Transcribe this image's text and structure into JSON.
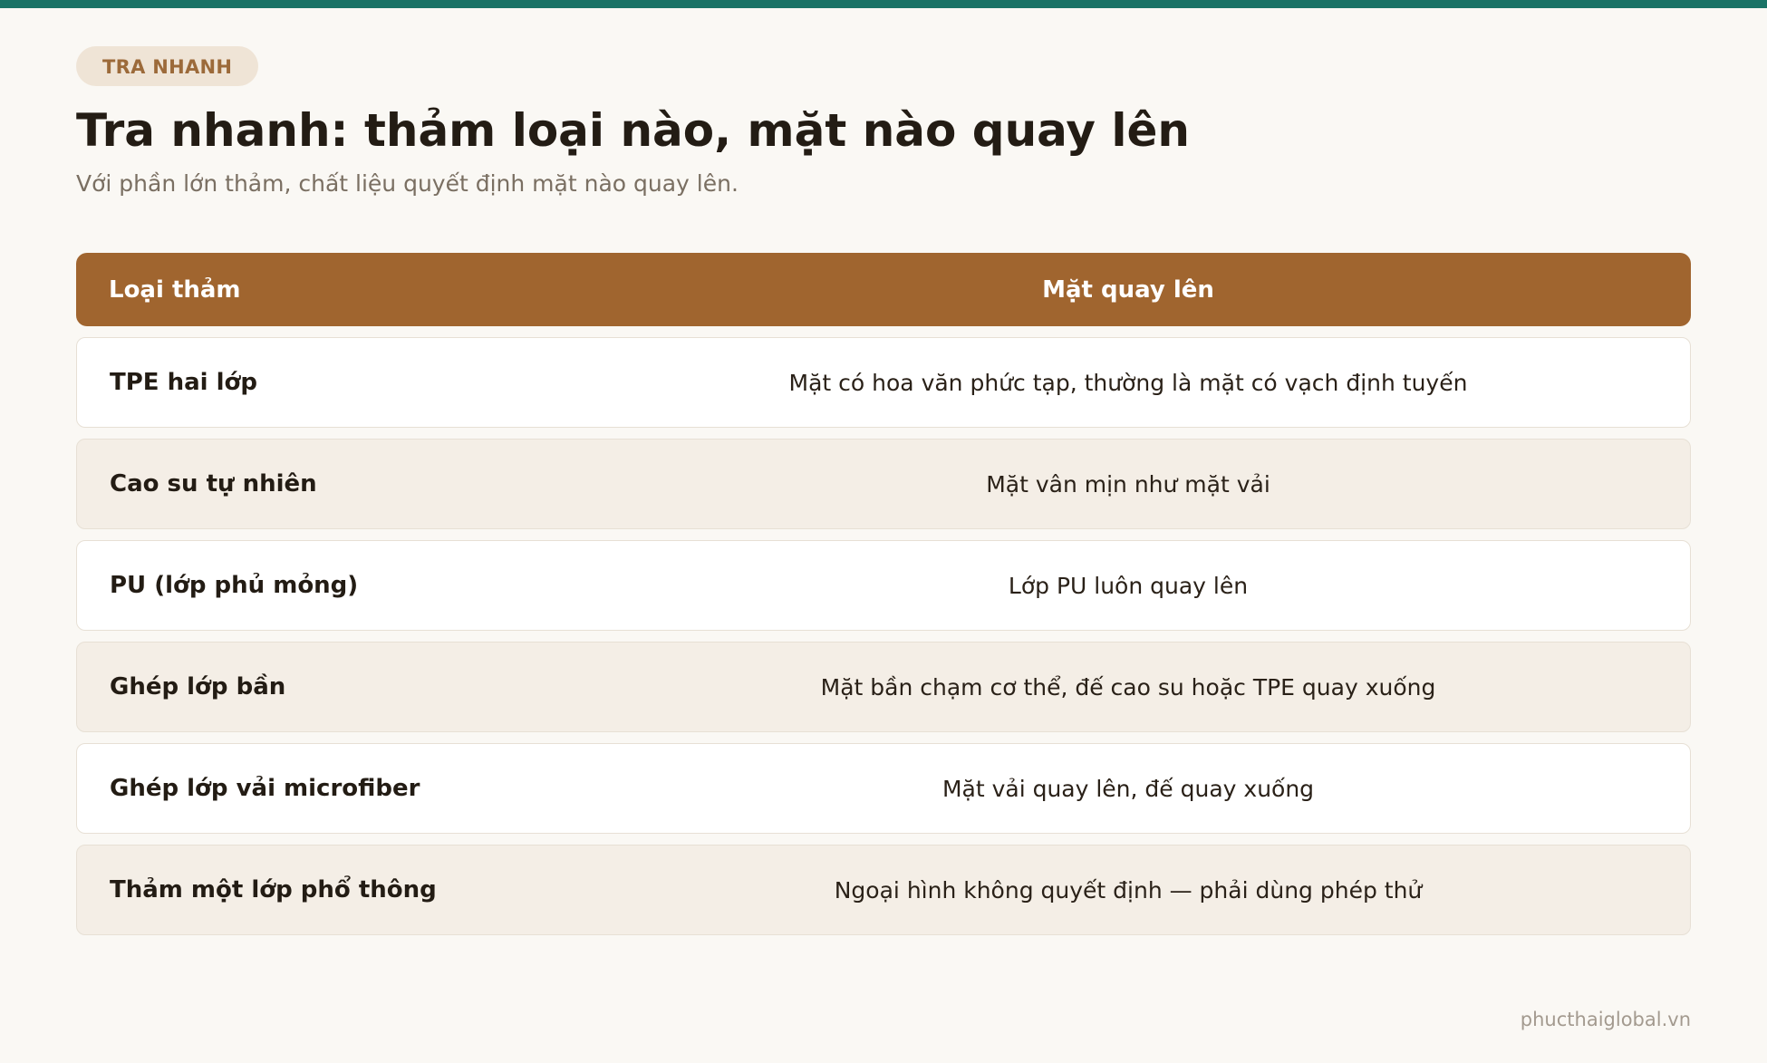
{
  "badge": "TRA NHANH",
  "title": "Tra nhanh: thảm loại nào, mặt nào quay lên",
  "subtitle": "Với phần lớn thảm, chất liệu quyết định mặt nào quay lên.",
  "table": {
    "headers": {
      "type": "Loại thảm",
      "side": "Mặt quay lên"
    },
    "rows": [
      {
        "type": "TPE hai lớp",
        "side": "Mặt có hoa văn phức tạp, thường là mặt có vạch định tuyến"
      },
      {
        "type": "Cao su tự nhiên",
        "side": "Mặt vân mịn như mặt vải"
      },
      {
        "type": "PU (lớp phủ mỏng)",
        "side": "Lớp PU luôn quay lên"
      },
      {
        "type": "Ghép lớp bần",
        "side": "Mặt bần chạm cơ thể, đế cao su hoặc TPE quay xuống"
      },
      {
        "type": "Ghép lớp vải microfiber",
        "side": "Mặt vải quay lên, đế quay xuống"
      },
      {
        "type": "Thảm một lớp phổ thông",
        "side": "Ngoại hình không quyết định — phải dùng phép thử"
      }
    ]
  },
  "footer": "phucthaiglobal.vn",
  "colors": {
    "accent_bar": "#1a7366",
    "header_bg": "#a0652f",
    "badge_bg": "#efe4d6",
    "badge_text": "#9c6a3a",
    "row_alt_bg": "#f4eee6",
    "page_bg": "#faf8f4"
  }
}
